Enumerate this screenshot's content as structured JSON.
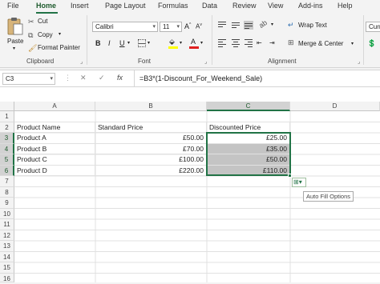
{
  "tabs": [
    "File",
    "Home",
    "Insert",
    "Page Layout",
    "Formulas",
    "Data",
    "Review",
    "View",
    "Add-ins",
    "Help"
  ],
  "active_tab": "Home",
  "ribbon": {
    "clipboard": {
      "paste": "Paste",
      "cut": "Cut",
      "copy": "Copy",
      "format_painter": "Format Painter",
      "label": "Clipboard"
    },
    "font": {
      "family": "Calibri",
      "size": "11",
      "bold": "B",
      "italic": "I",
      "underline": "U",
      "label": "Font"
    },
    "alignment": {
      "wrap_text": "Wrap Text",
      "merge_center": "Merge & Center",
      "label": "Alignment"
    },
    "number": {
      "format": "Curr"
    }
  },
  "formula_bar": {
    "name_box": "C3",
    "cancel": "✕",
    "enter": "✓",
    "fx": "fx",
    "formula": "=B3*(1-Discount_For_Weekend_Sale)"
  },
  "columns": [
    "A",
    "B",
    "C",
    "D"
  ],
  "rows": [
    "1",
    "2",
    "3",
    "4",
    "5",
    "6",
    "7",
    "8",
    "9",
    "10",
    "11",
    "12",
    "13",
    "14",
    "15",
    "16"
  ],
  "cells": {
    "A2": "Product Name",
    "B2": "Standard Price",
    "C2": "Discounted Price",
    "A3": "Product A",
    "B3": "£50.00",
    "C3": "£25.00",
    "A4": "Product B",
    "B4": "£70.00",
    "C4": "£35.00",
    "A5": "Product C",
    "B5": "£100.00",
    "C5": "£50.00",
    "A6": "Product D",
    "B6": "£220.00",
    "C6": "£110.00"
  },
  "selection": "C3:C6",
  "autofill_tooltip": "Auto Fill Options",
  "colors": {
    "accent": "#217346",
    "selection_fill": "#c4c4c4"
  }
}
